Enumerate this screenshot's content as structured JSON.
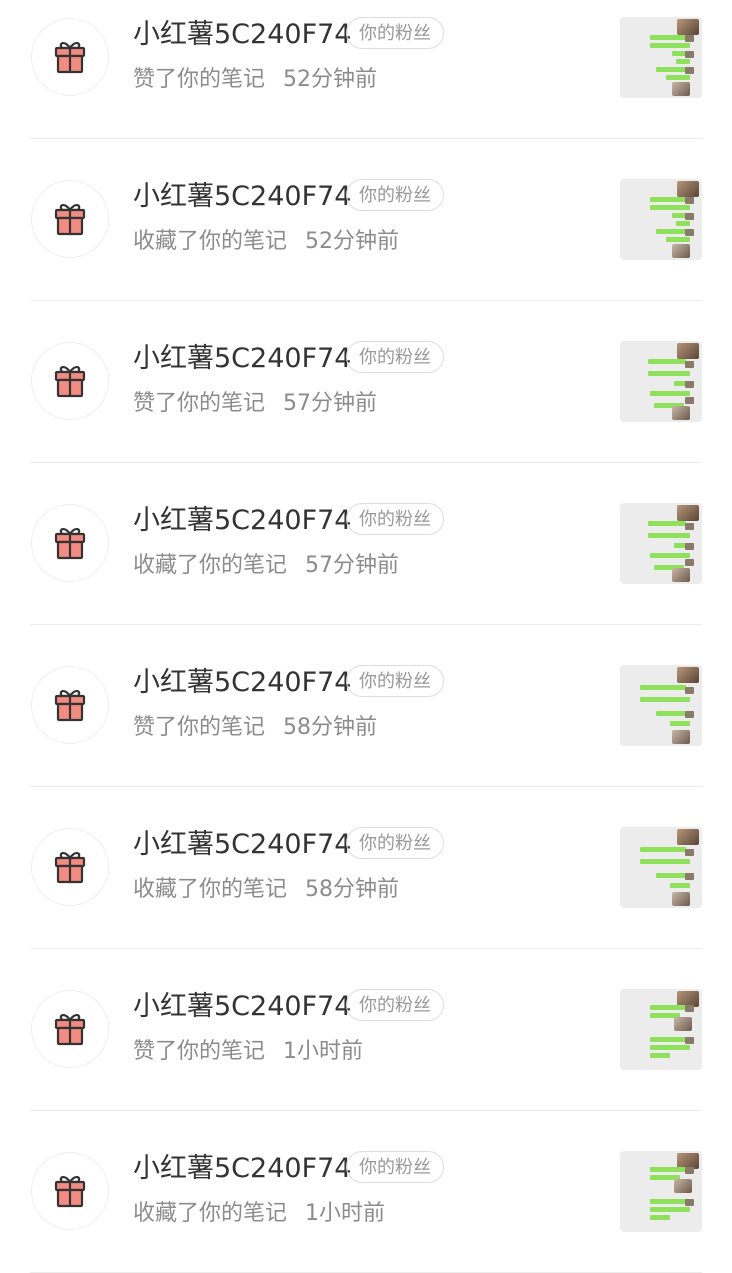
{
  "notifications": [
    {
      "name": "小红薯5C240F74",
      "badge": "你的粉丝",
      "action": "赞了你的笔记",
      "time": "52分钟前",
      "avatar_icon": "gift-icon",
      "thumb": "chat-screenshot-thumbnail"
    },
    {
      "name": "小红薯5C240F74",
      "badge": "你的粉丝",
      "action": "收藏了你的笔记",
      "time": "52分钟前",
      "avatar_icon": "gift-icon",
      "thumb": "chat-screenshot-thumbnail"
    },
    {
      "name": "小红薯5C240F74",
      "badge": "你的粉丝",
      "action": "赞了你的笔记",
      "time": "57分钟前",
      "avatar_icon": "gift-icon",
      "thumb": "chat-screenshot-thumbnail"
    },
    {
      "name": "小红薯5C240F74",
      "badge": "你的粉丝",
      "action": "收藏了你的笔记",
      "time": "57分钟前",
      "avatar_icon": "gift-icon",
      "thumb": "chat-screenshot-thumbnail"
    },
    {
      "name": "小红薯5C240F74",
      "badge": "你的粉丝",
      "action": "赞了你的笔记",
      "time": "58分钟前",
      "avatar_icon": "gift-icon",
      "thumb": "chat-screenshot-thumbnail"
    },
    {
      "name": "小红薯5C240F74",
      "badge": "你的粉丝",
      "action": "收藏了你的笔记",
      "time": "58分钟前",
      "avatar_icon": "gift-icon",
      "thumb": "chat-screenshot-thumbnail"
    },
    {
      "name": "小红薯5C240F74",
      "badge": "你的粉丝",
      "action": "赞了你的笔记",
      "time": "1小时前",
      "avatar_icon": "gift-icon",
      "thumb": "chat-screenshot-thumbnail"
    },
    {
      "name": "小红薯5C240F74",
      "badge": "你的粉丝",
      "action": "收藏了你的笔记",
      "time": "1小时前",
      "avatar_icon": "gift-icon",
      "thumb": "chat-screenshot-thumbnail"
    }
  ],
  "colors": {
    "gift_fill": "#f28b82",
    "gift_stroke": "#333333",
    "chat_bubble": "#8fe05a",
    "thumb_bg": "#ececec"
  }
}
